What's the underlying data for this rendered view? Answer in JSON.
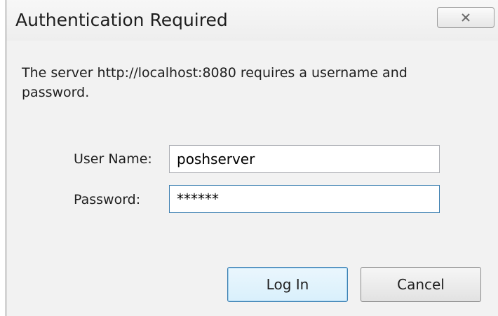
{
  "dialog": {
    "title": "Authentication Required",
    "close_icon": "close-x-icon",
    "message": "The server http://localhost:8080 requires a username and password."
  },
  "form": {
    "username_label": "User Name:",
    "username_value": "poshserver",
    "password_label": "Password:",
    "password_value": "******"
  },
  "buttons": {
    "login_label": "Log In",
    "cancel_label": "Cancel"
  },
  "colors": {
    "focus_border": "#3c7fb1",
    "window_background": "#f2f2f2"
  }
}
